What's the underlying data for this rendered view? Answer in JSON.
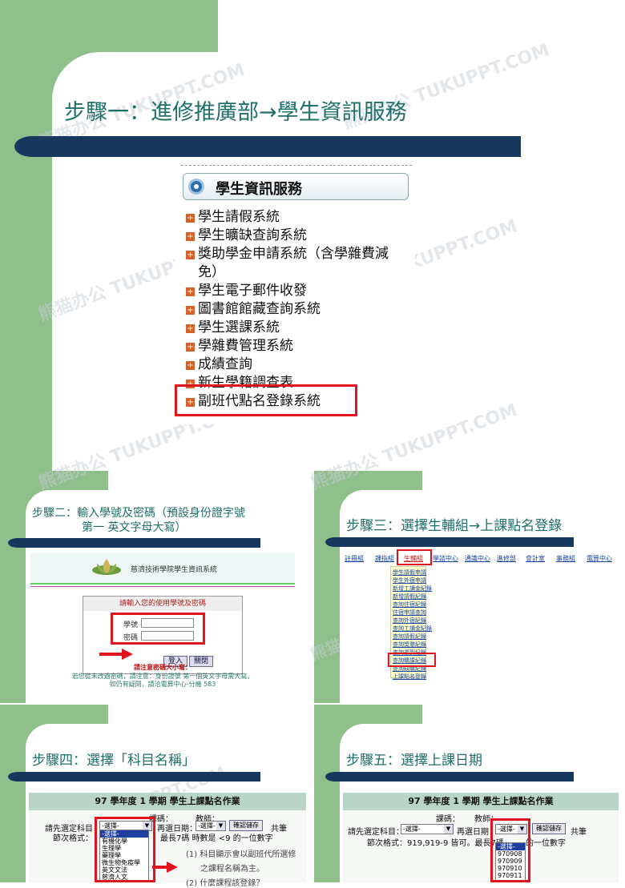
{
  "watermark": "熊猫办公 TUKUPPT.COM",
  "step1": {
    "title": "步驟一：進修推廣部→學生資訊服務",
    "panel_header": "學生資訊服務",
    "items": [
      "學生請假系統",
      "學生曠缺查詢系統",
      "獎助學金申請系統（含學雜費減",
      "免）",
      "學生電子郵件收發",
      "圖書館館藏查詢系統",
      "學生選課系統",
      "學雜費管理系統",
      "成績查詢",
      "新生學籍調查表",
      "副班代點名登錄系統"
    ]
  },
  "step2": {
    "title_line1": "步驟二：輸入學號及密碼（預設身份證字號",
    "title_line2": "第一 英文字母大寫）",
    "system_name": "慈濟技術學院學生資訊系統",
    "box_header": "請輸入您的使用學號及密碼",
    "id_label": "學號",
    "pw_label": "密碼",
    "login_button": "登入",
    "clear_button": "關閉",
    "warn": "請注意密碼大小寫：",
    "note1": "若您從未改過密碼，請注意：身份證號 第一個英文字母需大寫，",
    "note2": "如仍有疑問，請洽電算中心-分機 583"
  },
  "step3": {
    "title": "步驟三：選擇生輔組→上課點名登錄",
    "nav": [
      "註冊組",
      "課指組",
      "生輔組",
      "學諮中心",
      "通識中心",
      "進修部",
      "會計室",
      "事務組",
      "電算中心"
    ],
    "dropdown": [
      "學生請假申請",
      "學生外宿申請",
      "新增工讀金紀錄",
      "新增請假紀錄",
      "查詢住宿紀錄",
      "住宿申請查詢",
      "查詢外宿紀錄",
      "查詢工讀金紀錄",
      "查詢請假紀錄",
      "查詢獎懲紀錄",
      "查詢遲到紀錄",
      "查詢曠課紀錄",
      "查詢缺曠紀錄",
      "上課點名登錄"
    ]
  },
  "step4": {
    "title": "步驟四：選擇「科目名稱」",
    "form_title": "97 學年度 1 學期 學生上課點名作業",
    "course_label": "課碼：",
    "teacher_label": "教師：",
    "subject_label": "請先選定科目：",
    "select_placeholder": "-選擇-",
    "date_label": "再選日期：",
    "date_select": "-選擇-",
    "confirm_button": "確認儲存",
    "total": "共筆",
    "format_prefix": "節次格式：",
    "format_suffix": "最長7碼 時數是 <9 的一位數字",
    "options": [
      "-選擇-",
      "有機化學",
      "生理學",
      "藥理學",
      "微生物免疫學",
      "英文文法",
      "慈濟人文"
    ],
    "notes": [
      "(1) 科目顯示會以副班代所選修",
      "之課程名稱為主。",
      "(2) 什麼課程該登錄？"
    ]
  },
  "step5": {
    "title": "步驟五：選擇上課日期",
    "form_title": "97 學年度 1 學期 學生上課點名作業",
    "course_label": "課碼：",
    "teacher_label": "教師：",
    "subject_label": "請先選定科目：",
    "select_placeholder": "-選擇-",
    "date_label": "再選日期",
    "date_select": "-選擇-",
    "confirm_button": "確認儲存",
    "total": "共筆",
    "format": "節次格式：919,919-9 皆可。最長7碼",
    "format_tail": "的一位數字",
    "options": [
      "-選擇-",
      "970908",
      "970909",
      "970910",
      "970911"
    ]
  }
}
